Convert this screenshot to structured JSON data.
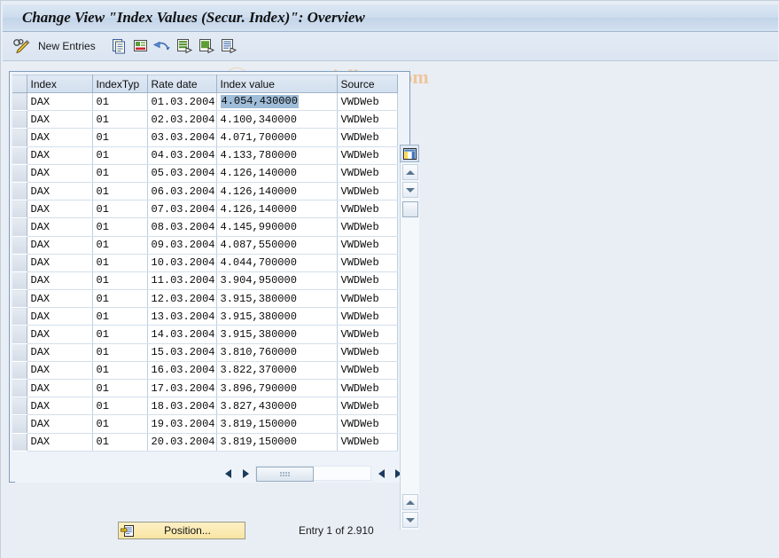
{
  "window": {
    "title": "Change View \"Index Values (Secur. Index)\": Overview"
  },
  "toolbar": {
    "change_icon": "pencil-display-change-icon",
    "new_entries_label": "New Entries",
    "icons": [
      {
        "name": "copy-icon"
      },
      {
        "name": "delete-icon"
      },
      {
        "name": "undo-icon"
      },
      {
        "name": "select-all-icon"
      },
      {
        "name": "deselect-all-icon"
      },
      {
        "name": "variant-list-icon"
      }
    ],
    "watermark": "www.tutorialkart.com"
  },
  "table": {
    "config_icon": "table-settings-icon",
    "columns": [
      "Index",
      "IndexTyp",
      "Rate date",
      "Index value",
      "Source"
    ],
    "selected_cell": {
      "row": 0,
      "column": "Index value"
    },
    "rows": [
      {
        "index": "DAX",
        "index_typ": "01",
        "rate_date": "01.03.2004",
        "index_value": "4.054,430000",
        "source": "VWDWeb"
      },
      {
        "index": "DAX",
        "index_typ": "01",
        "rate_date": "02.03.2004",
        "index_value": "4.100,340000",
        "source": "VWDWeb"
      },
      {
        "index": "DAX",
        "index_typ": "01",
        "rate_date": "03.03.2004",
        "index_value": "4.071,700000",
        "source": "VWDWeb"
      },
      {
        "index": "DAX",
        "index_typ": "01",
        "rate_date": "04.03.2004",
        "index_value": "4.133,780000",
        "source": "VWDWeb"
      },
      {
        "index": "DAX",
        "index_typ": "01",
        "rate_date": "05.03.2004",
        "index_value": "4.126,140000",
        "source": "VWDWeb"
      },
      {
        "index": "DAX",
        "index_typ": "01",
        "rate_date": "06.03.2004",
        "index_value": "4.126,140000",
        "source": "VWDWeb"
      },
      {
        "index": "DAX",
        "index_typ": "01",
        "rate_date": "07.03.2004",
        "index_value": "4.126,140000",
        "source": "VWDWeb"
      },
      {
        "index": "DAX",
        "index_typ": "01",
        "rate_date": "08.03.2004",
        "index_value": "4.145,990000",
        "source": "VWDWeb"
      },
      {
        "index": "DAX",
        "index_typ": "01",
        "rate_date": "09.03.2004",
        "index_value": "4.087,550000",
        "source": "VWDWeb"
      },
      {
        "index": "DAX",
        "index_typ": "01",
        "rate_date": "10.03.2004",
        "index_value": "4.044,700000",
        "source": "VWDWeb"
      },
      {
        "index": "DAX",
        "index_typ": "01",
        "rate_date": "11.03.2004",
        "index_value": "3.904,950000",
        "source": "VWDWeb"
      },
      {
        "index": "DAX",
        "index_typ": "01",
        "rate_date": "12.03.2004",
        "index_value": "3.915,380000",
        "source": "VWDWeb"
      },
      {
        "index": "DAX",
        "index_typ": "01",
        "rate_date": "13.03.2004",
        "index_value": "3.915,380000",
        "source": "VWDWeb"
      },
      {
        "index": "DAX",
        "index_typ": "01",
        "rate_date": "14.03.2004",
        "index_value": "3.915,380000",
        "source": "VWDWeb"
      },
      {
        "index": "DAX",
        "index_typ": "01",
        "rate_date": "15.03.2004",
        "index_value": "3.810,760000",
        "source": "VWDWeb"
      },
      {
        "index": "DAX",
        "index_typ": "01",
        "rate_date": "16.03.2004",
        "index_value": "3.822,370000",
        "source": "VWDWeb"
      },
      {
        "index": "DAX",
        "index_typ": "01",
        "rate_date": "17.03.2004",
        "index_value": "3.896,790000",
        "source": "VWDWeb"
      },
      {
        "index": "DAX",
        "index_typ": "01",
        "rate_date": "18.03.2004",
        "index_value": "3.827,430000",
        "source": "VWDWeb"
      },
      {
        "index": "DAX",
        "index_typ": "01",
        "rate_date": "19.03.2004",
        "index_value": "3.819,150000",
        "source": "VWDWeb"
      },
      {
        "index": "DAX",
        "index_typ": "01",
        "rate_date": "20.03.2004",
        "index_value": "3.819,150000",
        "source": "VWDWeb"
      }
    ]
  },
  "footer": {
    "position_button_label": "Position...",
    "position_icon": "position-jump-icon",
    "entry_info": "Entry 1 of 2.910"
  },
  "colors": {
    "title_bar": "#cdddee",
    "panel_border": "#7f9dbd",
    "selection_highlight": "#9fbcd8",
    "row_band": "#e7eff7",
    "button_yellow": "#f8e5a4",
    "watermark": "#eec69c"
  }
}
